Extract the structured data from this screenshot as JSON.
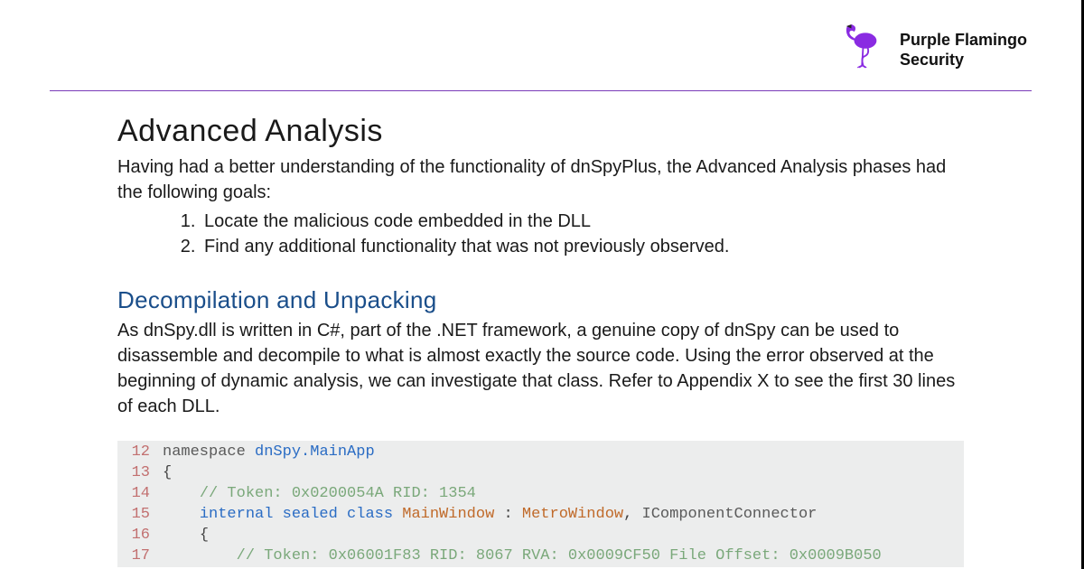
{
  "brand": {
    "line1": "Purple Flamingo",
    "line2": "Security",
    "icon": "flamingo-icon",
    "accent": "#8a2be2"
  },
  "heading1": "Advanced Analysis",
  "intro": "Having had a better understanding of the functionality of dnSpyPlus, the Advanced Analysis phases had the following goals:",
  "goals": [
    "Locate the malicious code embedded in the DLL",
    "Find any additional functionality that was not previously observed."
  ],
  "heading2": "Decompilation and Unpacking",
  "para": "As dnSpy.dll is written in C#, part of the .NET framework, a genuine copy of dnSpy can be used to disassemble and decompile to what is almost exactly the source code. Using the error observed at the beginning of dynamic analysis, we can investigate that class. Refer to Appendix X to see the first 30 lines of each DLL.",
  "code": {
    "lines": [
      {
        "n": "12",
        "tokens": [
          [
            "kw-ns",
            "namespace "
          ],
          [
            "name-type",
            "dnSpy.MainApp"
          ]
        ]
      },
      {
        "n": "13",
        "tokens": [
          [
            "brace",
            "{"
          ]
        ]
      },
      {
        "n": "14",
        "tokens": [
          [
            "",
            "    "
          ],
          [
            "comment",
            "// Token: 0x0200054A RID: 1354"
          ]
        ]
      },
      {
        "n": "15",
        "tokens": [
          [
            "",
            "    "
          ],
          [
            "kw-blue",
            "internal sealed class "
          ],
          [
            "cls-name",
            "MainWindow"
          ],
          [
            "",
            " : "
          ],
          [
            "cls-name2",
            "MetroWindow"
          ],
          [
            "",
            ", "
          ],
          [
            "iface",
            "IComponentConnector"
          ]
        ]
      },
      {
        "n": "16",
        "tokens": [
          [
            "",
            "    "
          ],
          [
            "brace",
            "{"
          ]
        ]
      },
      {
        "n": "17",
        "tokens": [
          [
            "",
            "        "
          ],
          [
            "comment",
            "// Token: 0x06001F83 RID: 8067 RVA: 0x0009CF50 File Offset: 0x0009B050"
          ]
        ]
      }
    ]
  }
}
